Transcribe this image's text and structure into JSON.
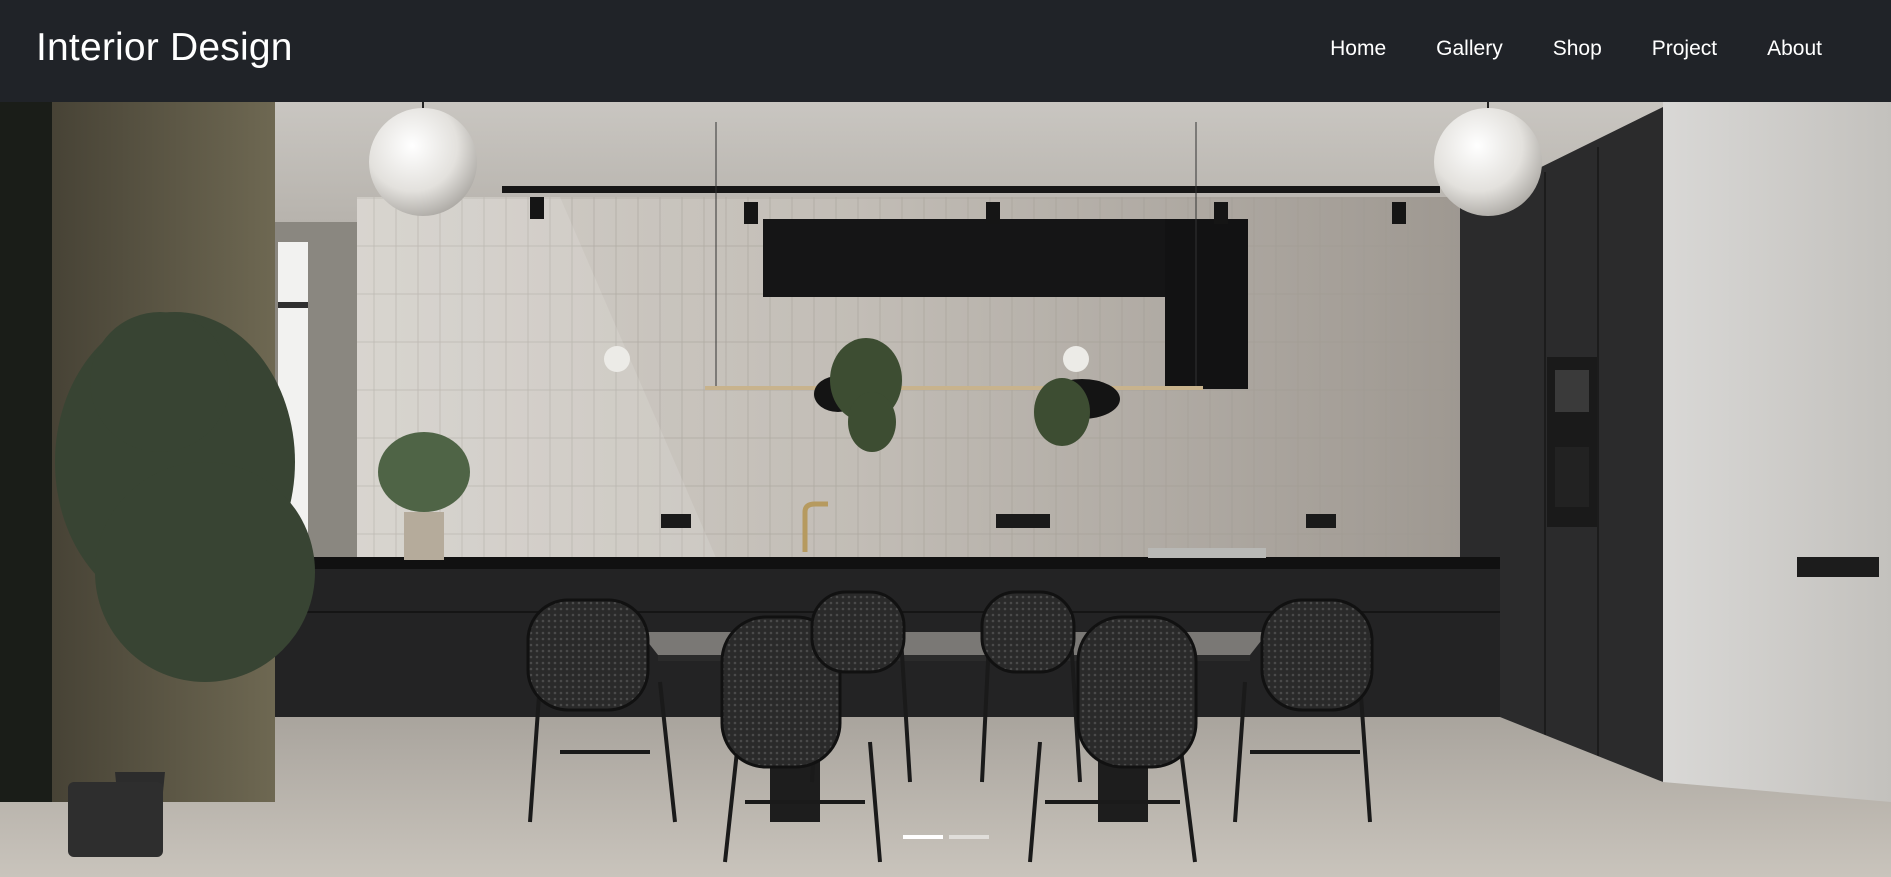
{
  "site": {
    "title": "Interior Design"
  },
  "nav": {
    "items": [
      {
        "label": "Home",
        "name": "nav-home"
      },
      {
        "label": "Gallery",
        "name": "nav-gallery"
      },
      {
        "label": "Shop",
        "name": "nav-shop"
      },
      {
        "label": "Project",
        "name": "nav-project"
      },
      {
        "label": "About",
        "name": "nav-about"
      }
    ]
  },
  "carousel": {
    "slides": 2,
    "active_index": 0
  },
  "colors": {
    "navbar": "#202328",
    "text": "#ffffff"
  }
}
